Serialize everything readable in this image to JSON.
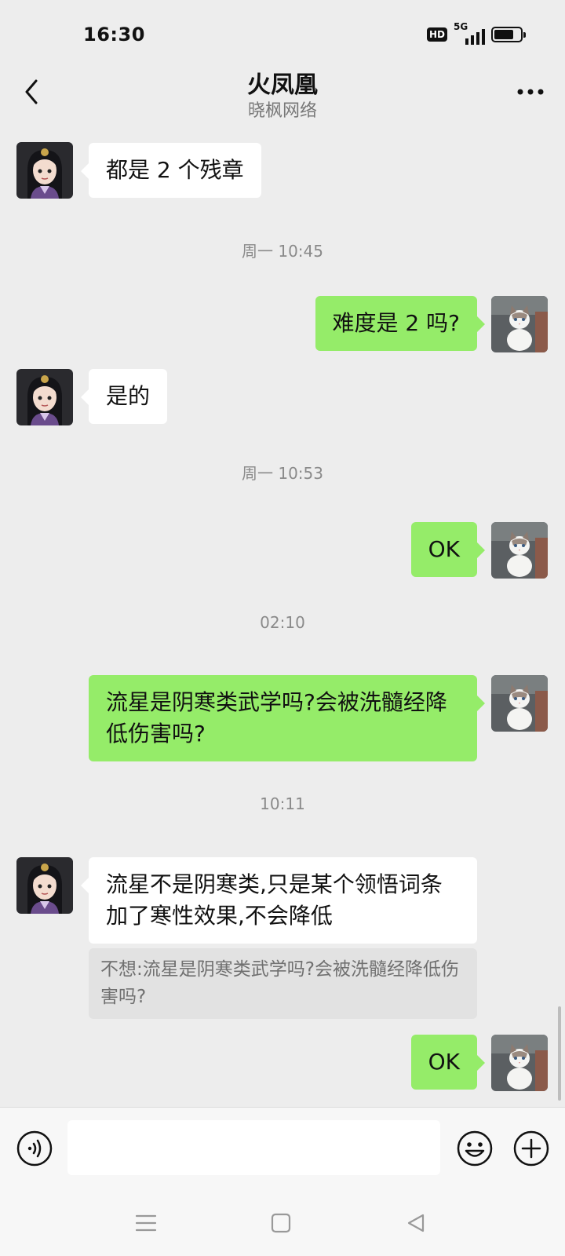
{
  "status_bar": {
    "time": "16:30",
    "hd_label": "HD",
    "network_label": "5G",
    "signal_bars": 4,
    "battery_level": 0.75
  },
  "header": {
    "title": "火凤凰",
    "subtitle": "晓枫网络",
    "back_icon": "chevron-left-icon",
    "more_icon": "more-dots-icon"
  },
  "messages": [
    {
      "sender": "other",
      "text": "都是 2 个残章"
    },
    {
      "type": "timestamp",
      "text": "周一 10:45"
    },
    {
      "sender": "me",
      "text": "难度是 2 吗?"
    },
    {
      "sender": "other",
      "text": "是的"
    },
    {
      "type": "timestamp",
      "text": "周一 10:53"
    },
    {
      "sender": "me",
      "text": "OK"
    },
    {
      "type": "timestamp",
      "text": "02:10"
    },
    {
      "sender": "me",
      "text": "流星是阴寒类武学吗?会被洗髓经降低伤害吗?"
    },
    {
      "type": "timestamp",
      "text": "10:11"
    },
    {
      "sender": "other",
      "text": "流星不是阴寒类,只是某个领悟词条加了寒性效果,不会降低",
      "quote": "不想:流星是阴寒类武学吗?会被洗髓经降低伤害吗?"
    },
    {
      "sender": "me",
      "text": "OK"
    }
  ],
  "input_bar": {
    "voice_icon": "voice-icon",
    "text_value": "",
    "emoji_icon": "emoji-icon",
    "plus_icon": "plus-circle-icon"
  },
  "nav_bar": {
    "menu_icon": "menu-icon",
    "home_icon": "home-square-icon",
    "back_icon": "back-triangle-icon"
  },
  "colors": {
    "background": "#ededed",
    "my_bubble": "#95ec69",
    "other_bubble": "#ffffff",
    "timestamp": "#8a8a8a",
    "quote_bg": "#e2e2e2"
  }
}
